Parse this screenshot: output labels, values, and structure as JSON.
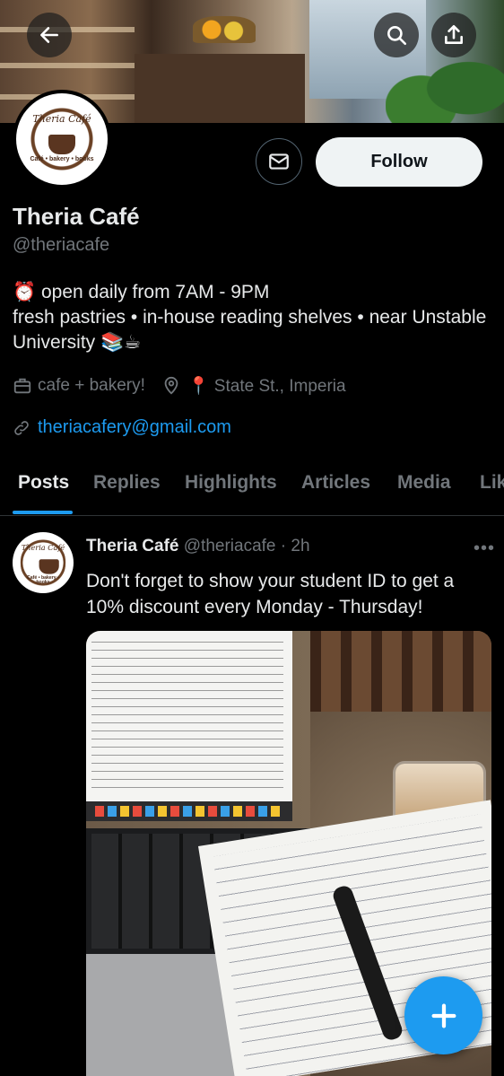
{
  "header": {
    "back_icon": "arrow-left-icon",
    "search_icon": "search-icon",
    "share_icon": "share-upload-icon"
  },
  "profile": {
    "logo_text": "Theria Café",
    "logo_subtext": "Café • bakery • books",
    "name": "Theria Café",
    "handle": "@theriacafe",
    "follow_label": "Follow",
    "message_icon": "envelope-icon",
    "bio_line1": "⏰ open daily from 7AM - 9PM",
    "bio_line2": "fresh pastries • in-house reading shelves • near Unstable University 📚☕",
    "category": "cafe + bakery!",
    "location": "📍 State St., Imperia",
    "email": "theriacafery@gmail.com"
  },
  "tabs": [
    {
      "label": "Posts"
    },
    {
      "label": "Replies"
    },
    {
      "label": "Highlights"
    },
    {
      "label": "Articles"
    },
    {
      "label": "Media"
    },
    {
      "label": "Likes"
    }
  ],
  "post": {
    "name": "Theria Café",
    "handle": "@theriacafe",
    "time": "2h",
    "more": "•••",
    "text": "Don't forget to show your student ID to get a 10% discount every Monday - Thursday!"
  },
  "colors": {
    "accent": "#1d9bf0",
    "background": "#000000",
    "muted": "#71767b"
  },
  "fab": {
    "icon": "plus-icon"
  }
}
